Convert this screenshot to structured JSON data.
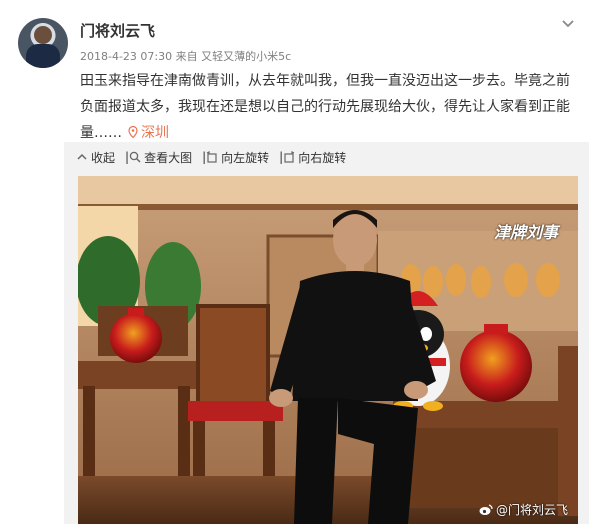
{
  "post": {
    "author": "门将刘云飞",
    "timestamp": "2018-4-23 07:30",
    "source_prefix": "来自",
    "source": "又轻又薄的小米5c",
    "text": "田玉来指导在津南做青训，从去年就叫我，但我一直没迈出这一步去。毕竟之前负面报道太多，我现在还是想以自己的行动先展现给大伙，得先让人家看到正能量……",
    "location": "深圳"
  },
  "toolbar": {
    "collapse_label": "收起",
    "view_large_label": "查看大图",
    "rotate_left_label": "向左旋转",
    "rotate_right_label": "向右旋转"
  },
  "photo": {
    "watermark_tl": "津牌刘事",
    "credit": "@门将刘云飞"
  },
  "colors": {
    "accent": "#eb7350",
    "muted": "#808080",
    "panel": "#f2f2f2"
  }
}
